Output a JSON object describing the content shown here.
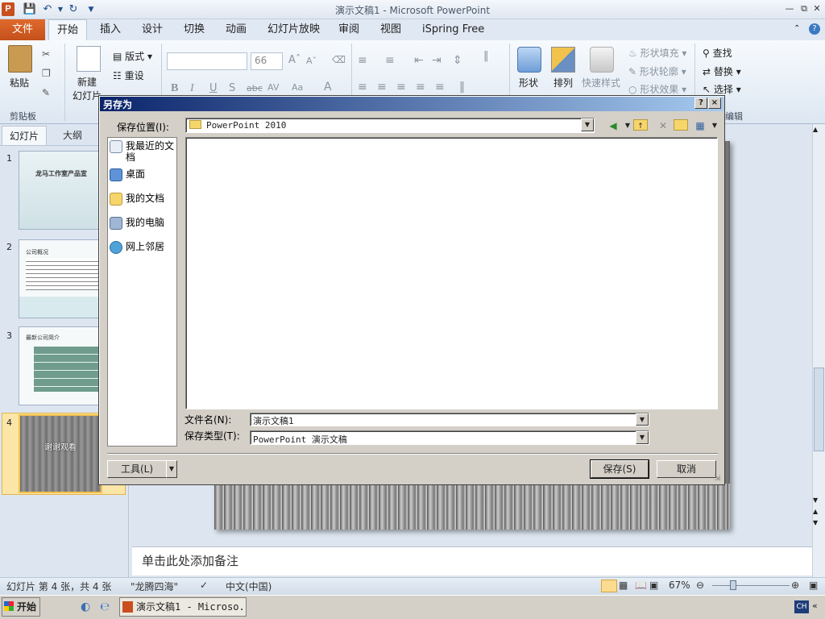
{
  "window": {
    "title": "演示文稿1 - Microsoft PowerPoint",
    "app_icon": "P"
  },
  "ribbon_tabs": [
    "文件",
    "开始",
    "插入",
    "设计",
    "切换",
    "动画",
    "幻灯片放映",
    "审阅",
    "视图",
    "iSpring Free"
  ],
  "ribbon": {
    "clipboard": {
      "paste": "粘贴",
      "group_label": "剪贴板"
    },
    "slides": {
      "new_slide": "新建",
      "new_slide_2": "幻灯片",
      "layout": "版式",
      "reset": "重设"
    },
    "font": {
      "size": "66"
    },
    "drawing": {
      "shape": "形状",
      "arrange": "排列",
      "quick_styles": "快速样式",
      "fill": "形状填充",
      "outline": "形状轮廓",
      "effects": "形状效果"
    },
    "editing": {
      "find": "查找",
      "replace": "替换",
      "select": "选择",
      "group_label": "编辑"
    }
  },
  "slide_panel": {
    "tabs": [
      "幻灯片",
      "大纲"
    ],
    "thumbnails": [
      {
        "num": "1",
        "title": "龙马工作室产品宣"
      },
      {
        "num": "2",
        "title": "公司概况"
      },
      {
        "num": "3",
        "title": "最新公司简介"
      },
      {
        "num": "4",
        "title": "谢谢观看"
      }
    ]
  },
  "notes_placeholder": "单击此处添加备注",
  "statusbar": {
    "slide_info": "幻灯片 第 4 张，共 4 张",
    "theme": "\"龙腾四海\"",
    "language": "中文(中国)",
    "zoom": "67%"
  },
  "taskbar": {
    "start": "开始",
    "task": "演示文稿1 - Microso...",
    "ime": "CH"
  },
  "dialog": {
    "title": "另存为",
    "help": "?",
    "close": "×",
    "save_in_label": "保存位置(I):",
    "save_in_value": "PowerPoint 2010",
    "places": [
      "我最近的文档",
      "桌面",
      "我的文档",
      "我的电脑",
      "网上邻居"
    ],
    "filename_label": "文件名(N):",
    "filename_value": "演示文稿1",
    "filetype_label": "保存类型(T):",
    "filetype_value": "PowerPoint 演示文稿",
    "tools_button": "工具(L)",
    "save_button": "保存(S)",
    "cancel_button": "取消"
  }
}
